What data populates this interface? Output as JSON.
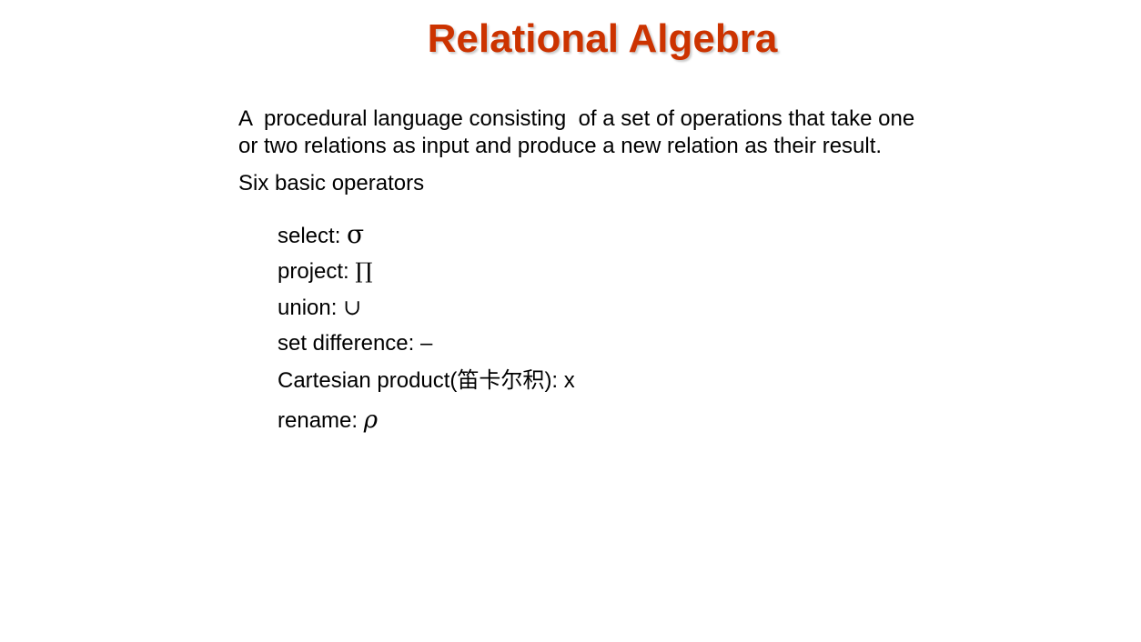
{
  "slide": {
    "title": "Relational Algebra",
    "intro": {
      "line1": "A  procedural language consisting  of a set of operations that take one",
      "line2": "or two relations as input and produce a new relation as their result."
    },
    "subheading": "Six basic operators",
    "operators": [
      {
        "label": "select:",
        "symbol": "σ",
        "symbol_icon": "sigma-icon"
      },
      {
        "label": "project:",
        "symbol": "∏",
        "symbol_icon": "pi-icon"
      },
      {
        "label": "union:",
        "symbol": "∪",
        "symbol_icon": "cup-icon"
      },
      {
        "label": "set difference:",
        "symbol": "–",
        "symbol_icon": "minus-icon"
      },
      {
        "label": "Cartesian product(",
        "cjk": "笛卡尔积",
        "label_suffix": "):",
        "symbol": "x",
        "symbol_icon": "times-icon"
      },
      {
        "label": "rename:",
        "symbol": "ρ",
        "symbol_icon": "rho-icon"
      }
    ],
    "colors": {
      "title": "#cc3300",
      "text": "#000000",
      "background": "#ffffff"
    }
  }
}
